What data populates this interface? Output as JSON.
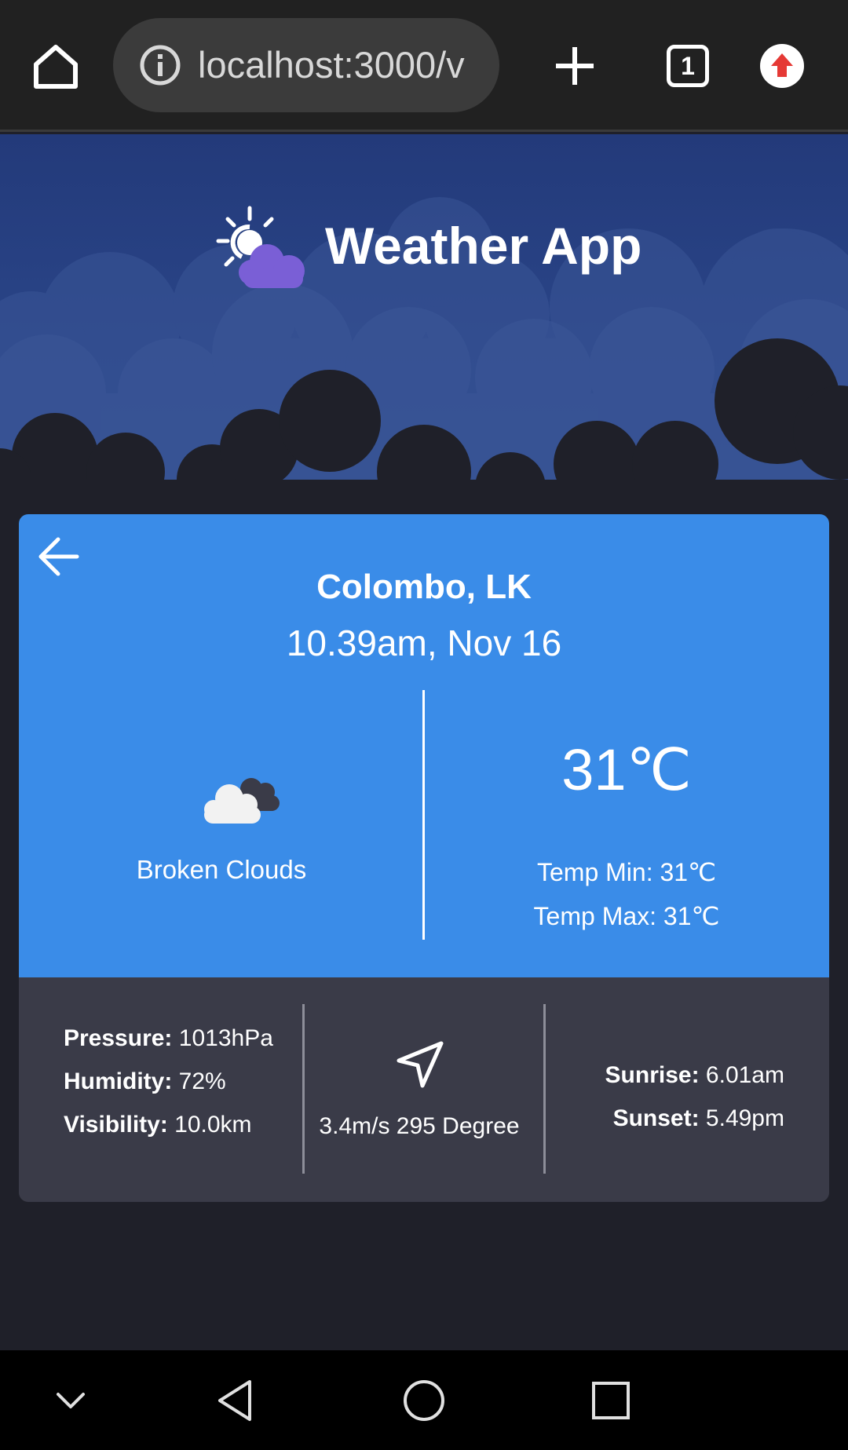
{
  "browser": {
    "url": "localhost:3000/v",
    "tab_count": "1",
    "icons": {
      "home": "home-icon",
      "info": "info-icon",
      "new_tab": "plus-icon",
      "profile": "upload-arrow-icon"
    }
  },
  "header": {
    "title": "Weather App",
    "logo": "sun-behind-cloud-icon"
  },
  "weather": {
    "location": "Colombo, LK",
    "datetime": "10.39am, Nov 16",
    "condition": "Broken Clouds",
    "temperature": "31℃",
    "temp_min_label": "Temp Min:",
    "temp_min_value": "31℃",
    "temp_max_label": "Temp Max:",
    "temp_max_value": "31℃",
    "pressure_label": "Pressure:",
    "pressure_value": "1013hPa",
    "humidity_label": "Humidity:",
    "humidity_value": "72%",
    "visibility_label": "Visibility:",
    "visibility_value": "10.0km",
    "wind": "3.4m/s 295 Degree",
    "sunrise_label": "Sunrise:",
    "sunrise_value": "6.01am",
    "sunset_label": "Sunset:",
    "sunset_value": "5.49pm"
  },
  "colors": {
    "card_top": "#3a8ce8",
    "card_bottom": "#3a3b48",
    "hero": "#2a4588",
    "page_background": "#1f2029",
    "logo_cloud": "#7a5fd6"
  },
  "system_nav": {
    "icons": [
      "chevron-down-icon",
      "back-triangle-icon",
      "home-circle-icon",
      "recents-square-icon"
    ]
  }
}
